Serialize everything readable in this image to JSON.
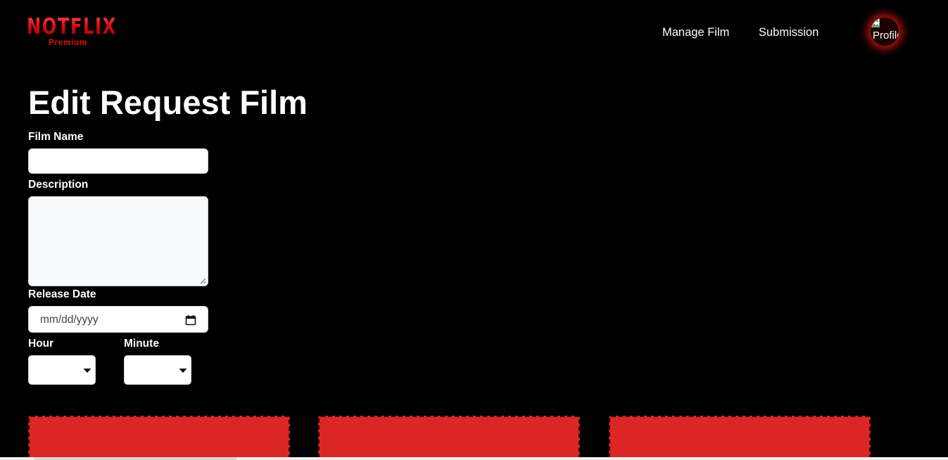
{
  "header": {
    "logo_text": "NOTFLIX",
    "logo_subtitle": "Premium",
    "nav": {
      "manage_film": "Manage Film",
      "submission": "Submission"
    },
    "avatar_alt": "Profile"
  },
  "page": {
    "title": "Edit Request Film"
  },
  "form": {
    "film_name": {
      "label": "Film Name",
      "value": ""
    },
    "description": {
      "label": "Description",
      "value": ""
    },
    "release_date": {
      "label": "Release Date",
      "display": "mm/dd/yyyy"
    },
    "hour": {
      "label": "Hour",
      "selected": ""
    },
    "minute": {
      "label": "Minute",
      "selected": ""
    }
  },
  "colors": {
    "background": "#000000",
    "brand_red": "#e50914",
    "card_red": "#dc2626"
  },
  "icons": {
    "calendar": "calendar-icon",
    "dropdown": "caret-down-icon",
    "broken_image": "broken-image-icon",
    "resize": "resize-grip-icon"
  }
}
